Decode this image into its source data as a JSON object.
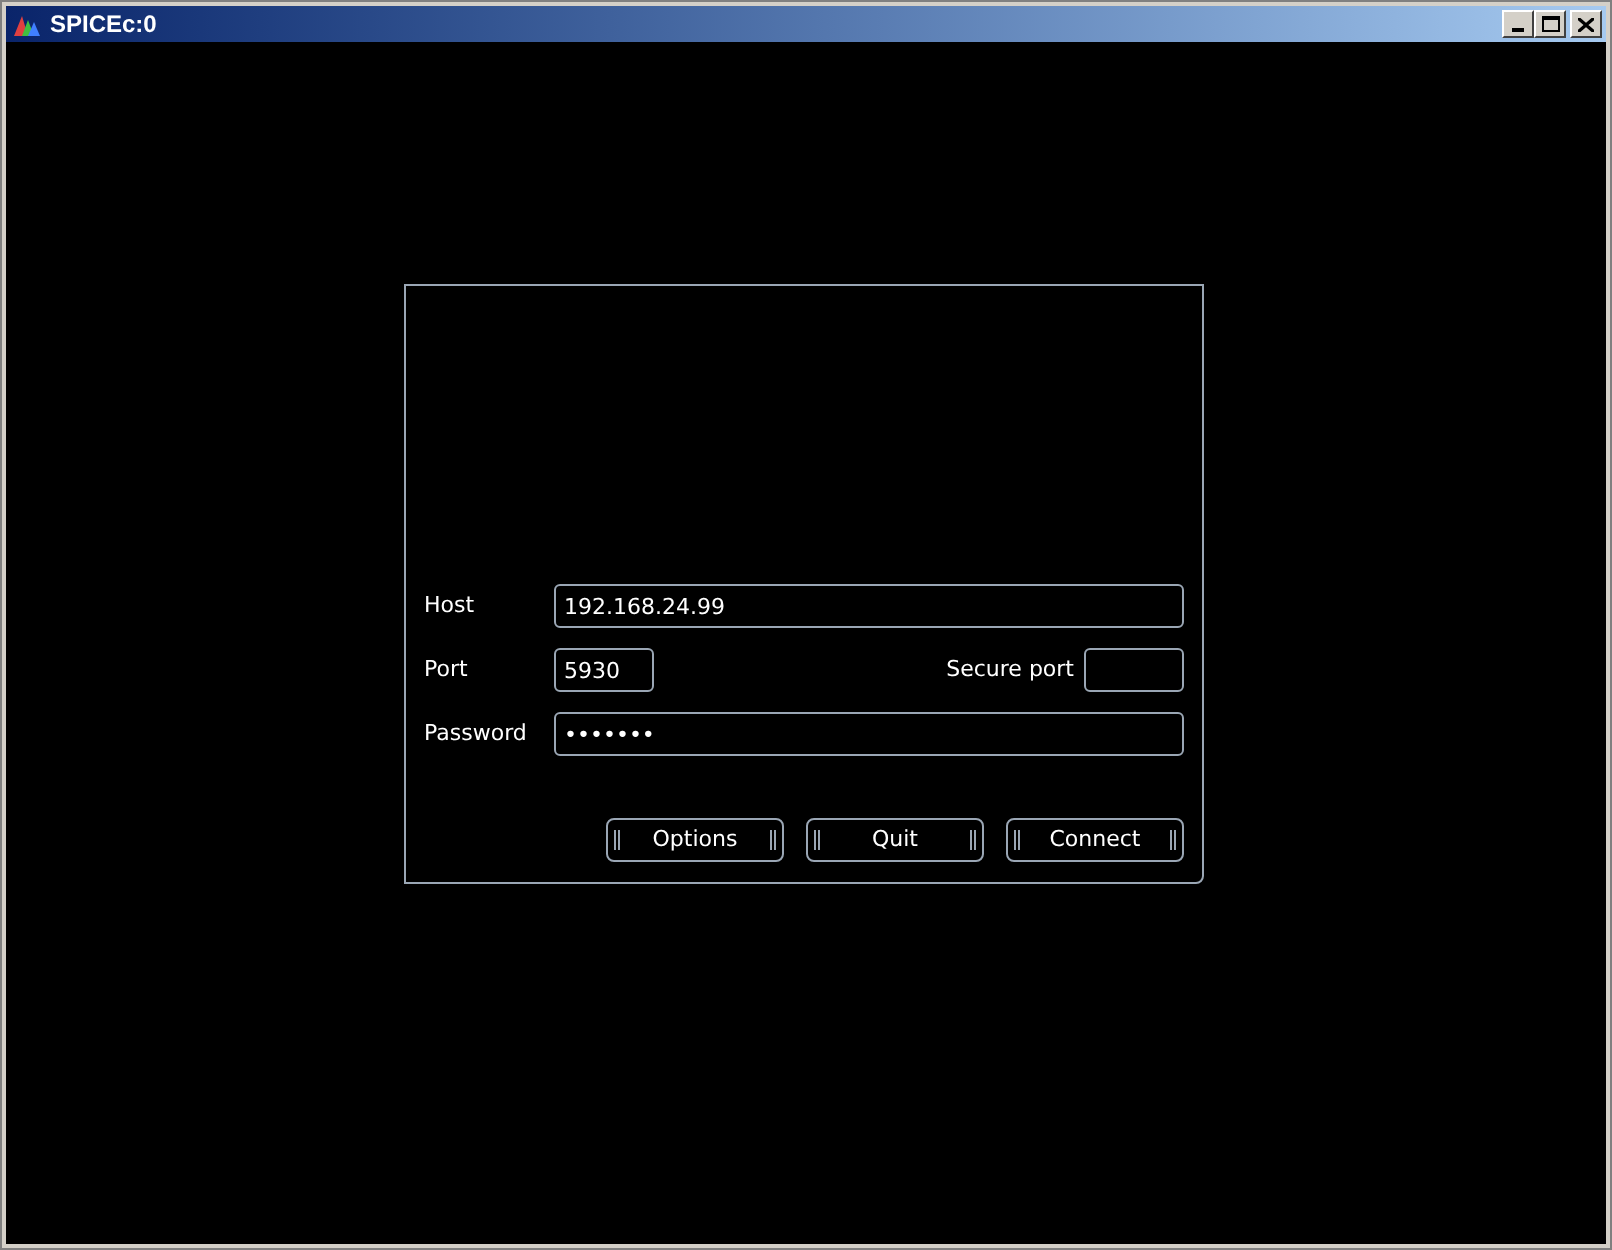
{
  "window": {
    "title": "SPICEc:0"
  },
  "form": {
    "host": {
      "label": "Host",
      "value": "192.168.24.99"
    },
    "port": {
      "label": "Port",
      "value": "5930"
    },
    "secure_port": {
      "label": "Secure port"
    },
    "password": {
      "label": "Password",
      "value": "•••••••"
    }
  },
  "buttons": [
    {
      "label": "Options"
    },
    {
      "label": "Quit"
    },
    {
      "label": "Connect"
    }
  ]
}
